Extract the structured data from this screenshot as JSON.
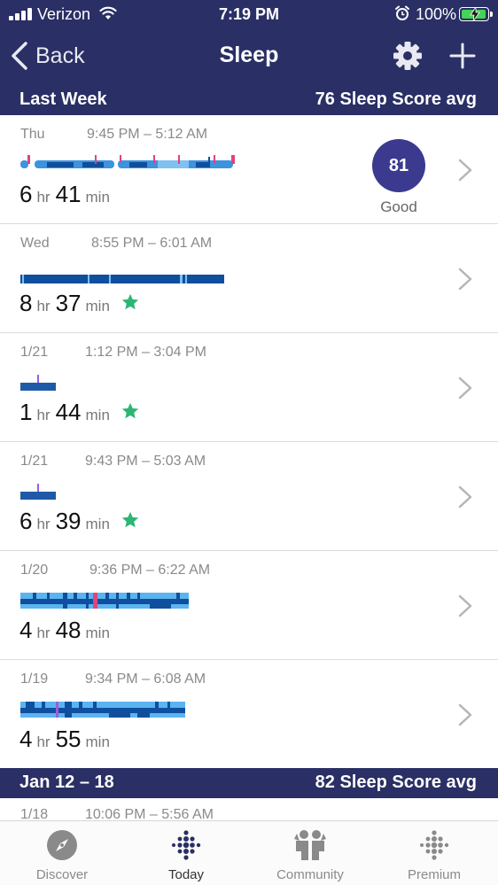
{
  "status_bar": {
    "carrier": "Verizon",
    "time": "7:19 PM",
    "battery": "100%",
    "battery_level": 1.0
  },
  "nav": {
    "back_label": "Back",
    "title": "Sleep",
    "left_icon": "chevron-left-icon",
    "right_icons": [
      "gear-icon",
      "plus-icon"
    ]
  },
  "sections": [
    {
      "left": "Last Week",
      "right": "76 Sleep Score avg"
    },
    {
      "left": "Jan 12 – 18",
      "right": "82 Sleep Score avg"
    }
  ],
  "rows": [
    {
      "date": "Thu",
      "time_range": "9:45 PM – 5:12 AM",
      "hours": "6",
      "hr_unit": "hr",
      "minutes": "41",
      "min_unit": "min",
      "star": false,
      "score": "81",
      "score_label": "Good"
    },
    {
      "date": "Wed",
      "time_range": "8:55 PM – 6:01 AM",
      "hours": "8",
      "hr_unit": "hr",
      "minutes": "37",
      "min_unit": "min",
      "star": true
    },
    {
      "date": "1/21",
      "time_range": "1:12 PM – 3:04 PM",
      "hours": "1",
      "hr_unit": "hr",
      "minutes": "44",
      "min_unit": "min",
      "star": true
    },
    {
      "date": "1/21",
      "time_range": "9:43 PM – 5:03 AM",
      "hours": "6",
      "hr_unit": "hr",
      "minutes": "39",
      "min_unit": "min",
      "star": true
    },
    {
      "date": "1/20",
      "time_range": "9:36 PM – 6:22 AM",
      "hours": "4",
      "hr_unit": "hr",
      "minutes": "48",
      "min_unit": "min",
      "star": false
    },
    {
      "date": "1/19",
      "time_range": "9:34 PM – 6:08 AM",
      "hours": "4",
      "hr_unit": "hr",
      "minutes": "55",
      "min_unit": "min",
      "star": false
    }
  ],
  "partial_row": {
    "date": "1/18",
    "time_range": "10:06 PM – 5:56 AM"
  },
  "tabs": [
    {
      "label": "Discover",
      "icon": "compass-icon",
      "active": false
    },
    {
      "label": "Today",
      "icon": "fitbit-dots-icon",
      "active": true
    },
    {
      "label": "Community",
      "icon": "community-icon",
      "active": false
    },
    {
      "label": "Premium",
      "icon": "premium-dots-icon",
      "active": false
    }
  ],
  "colors": {
    "header_bg": "#2a2f65",
    "score_circle": "#3b3a8f",
    "deep_sleep": "#0f4f9e",
    "light_sleep": "#3d93e0",
    "rem_sleep": "#7fc1f1",
    "awake": "#e0447a",
    "star": "#2bb673"
  }
}
